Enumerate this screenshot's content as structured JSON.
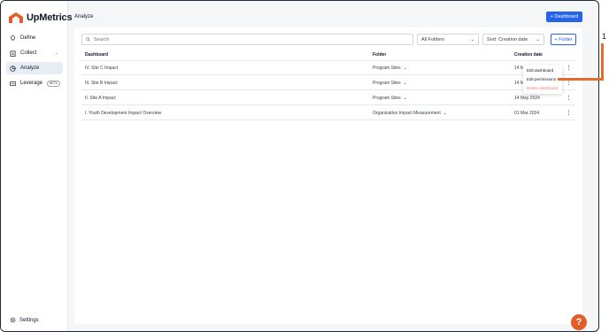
{
  "brand": {
    "name": "UpMetrics",
    "accent": "#2563eb",
    "logo_color": "#e35d2a"
  },
  "sidebar": {
    "items": [
      {
        "label": "Define",
        "icon": "lightbulb-icon"
      },
      {
        "label": "Collect",
        "icon": "clipboard-icon"
      },
      {
        "label": "Analyze",
        "icon": "chart-circle-icon",
        "active": true
      },
      {
        "label": "Leverage",
        "icon": "gauge-icon",
        "badge": "BETA"
      }
    ],
    "settings_label": "Settings"
  },
  "header": {
    "title": "Analyze",
    "dashboard_button": "+ Dashboard"
  },
  "toolbar": {
    "search_placeholder": "Search",
    "folder_select": "All Folders",
    "sort_select": "Sort: Creation date",
    "folder_button": "+ Folder"
  },
  "table": {
    "columns": [
      "Dashboard",
      "Folder",
      "Creation date"
    ],
    "rows": [
      {
        "dashboard": "IV. Site C Impact",
        "folder": "Program Sites",
        "date": "14 M"
      },
      {
        "dashboard": "III. Site B Impact",
        "folder": "Program Sites",
        "date": "14 M"
      },
      {
        "dashboard": "II. Site A Impact",
        "folder": "Program Sites",
        "date": "14 May 2024"
      },
      {
        "dashboard": "I. Youth Development Impact Overview",
        "folder": "Organization Impact Measurement",
        "date": "01 Mar 2024"
      }
    ]
  },
  "menu": {
    "items": [
      "Edit dashboard",
      "Edit permissions",
      "Delete dashboard"
    ]
  },
  "annotation": {
    "number": "1",
    "color": "#e36b2c"
  },
  "help": {
    "label": "?"
  }
}
